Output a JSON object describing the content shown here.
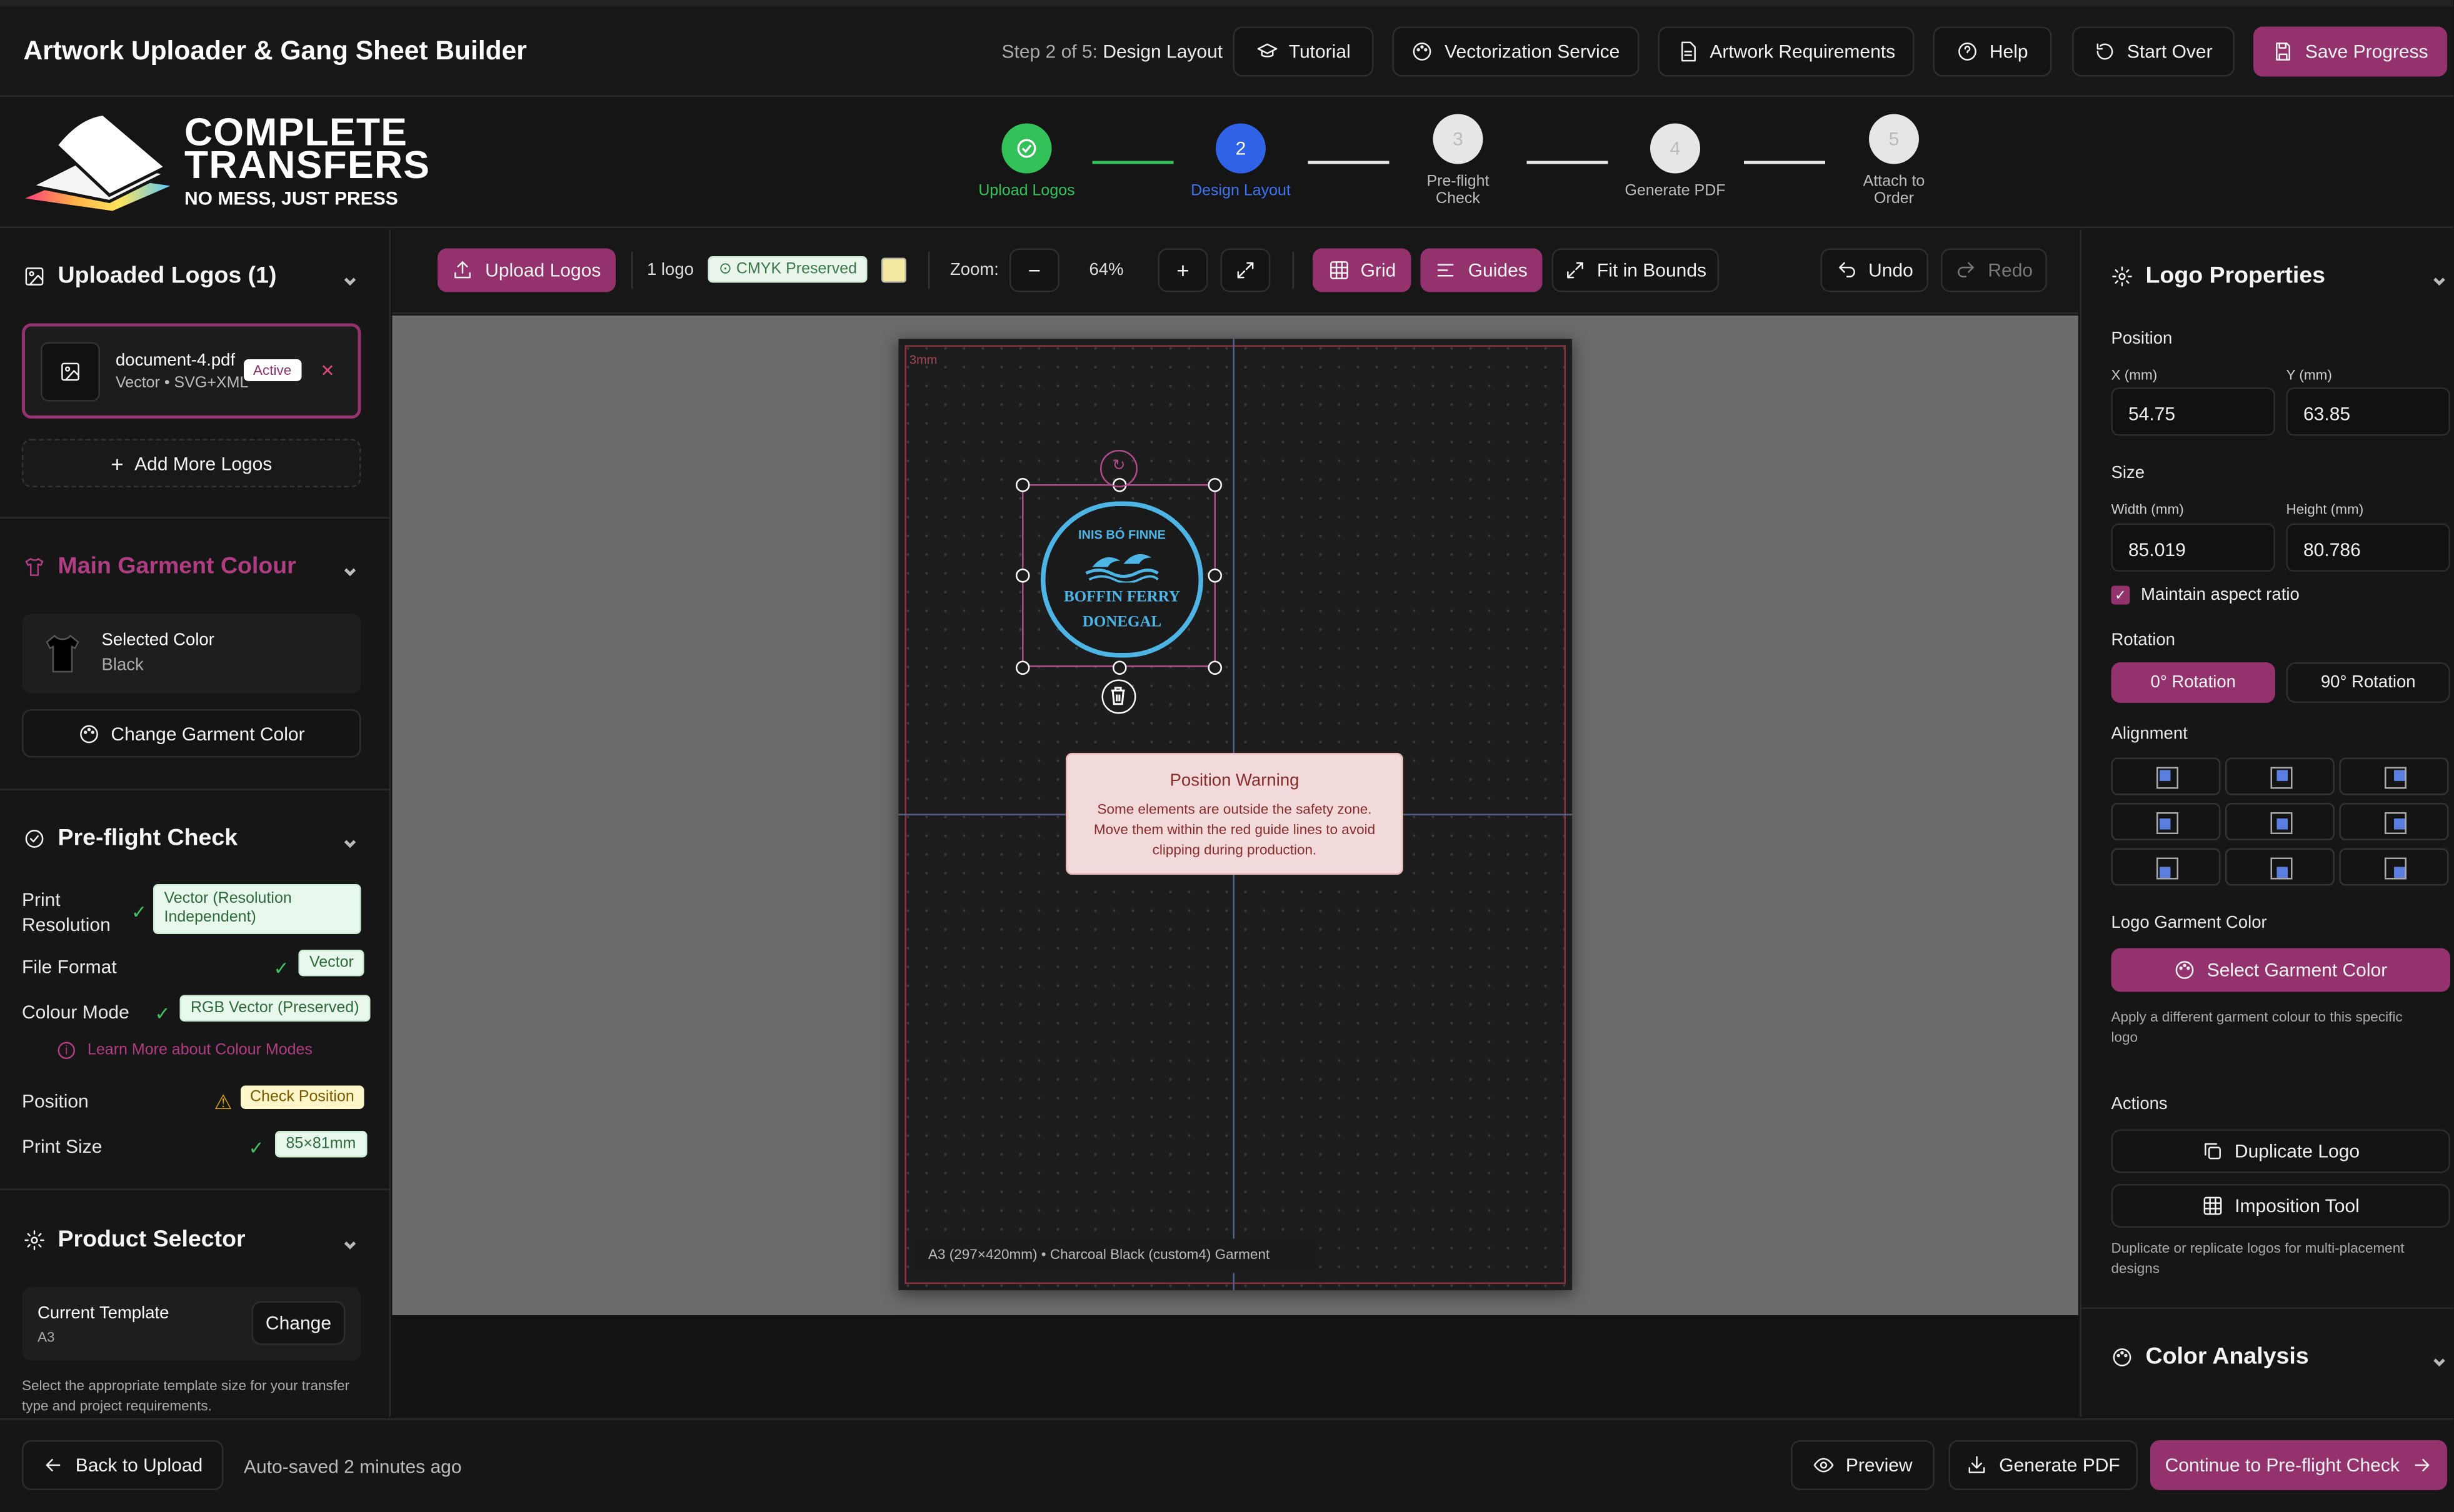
{
  "header": {
    "title": "Artwork Uploader & Gang Sheet Builder",
    "step_prefix": "Step 2 of 5:",
    "step_name": "Design Layout",
    "buttons": {
      "tutorial": "Tutorial",
      "vectorization": "Vectorization Service",
      "requirements": "Artwork Requirements",
      "help": "Help",
      "start_over": "Start Over",
      "save": "Save Progress"
    }
  },
  "brand": {
    "line1": "COMPLETE",
    "line2": "TRANSFERS",
    "tagline": "NO MESS, JUST PRESS"
  },
  "stepper": [
    {
      "num": "1",
      "label": "Upload Logos",
      "state": "done"
    },
    {
      "num": "2",
      "label": "Design Layout",
      "state": "active"
    },
    {
      "num": "3",
      "label": "Pre-flight Check",
      "state": "todo"
    },
    {
      "num": "4",
      "label": "Generate PDF",
      "state": "todo"
    },
    {
      "num": "5",
      "label": "Attach to Order",
      "state": "todo"
    }
  ],
  "left": {
    "uploaded": {
      "title": "Uploaded Logos (1)",
      "file": {
        "name": "document-4.pdf",
        "meta": "Vector • SVG+XML",
        "badge": "Active"
      },
      "add_more": "Add More Logos"
    },
    "garment": {
      "title": "Main Garment Colour",
      "selected_label": "Selected Color",
      "selected_value": "Black",
      "change_button": "Change Garment Color"
    },
    "preflight": {
      "title": "Pre-flight Check",
      "rows": [
        {
          "label": "Print Resolution",
          "value": "Vector (Resolution Independent)",
          "status": "ok"
        },
        {
          "label": "File Format",
          "value": "Vector",
          "status": "ok"
        },
        {
          "label": "Colour Mode",
          "value": "RGB Vector (Preserved)",
          "status": "ok"
        },
        {
          "label": "Position",
          "value": "Check Position",
          "status": "warn"
        },
        {
          "label": "Print Size",
          "value": "85×81mm",
          "status": "ok"
        }
      ],
      "learn_more": "Learn More about Colour Modes"
    },
    "product": {
      "title": "Product Selector",
      "current_label": "Current Template",
      "current_value": "A3",
      "change_button": "Change",
      "note": "Select the appropriate template size for your transfer type and project requirements."
    }
  },
  "toolbar": {
    "upload": "Upload Logos",
    "count": "1 logo",
    "cmyk": "CMYK Preserved",
    "zoom_label": "Zoom:",
    "zoom_value": "64%",
    "grid": "Grid",
    "guides": "Guides",
    "fit": "Fit in Bounds",
    "undo": "Undo",
    "redo": "Redo"
  },
  "canvas": {
    "safety_label": "3mm",
    "logo": {
      "top": "INIS BÓ FINNE",
      "line1": "BOFFIN FERRY",
      "line2": "DONEGAL"
    },
    "warning": {
      "title": "Position Warning",
      "body": "Some elements are outside the safety zone. Move them within the red guide lines to avoid clipping during production."
    },
    "footer": "A3 (297×420mm) • Charcoal Black (custom4) Garment"
  },
  "right": {
    "title": "Logo Properties",
    "position_title": "Position",
    "x_label": "X (mm)",
    "x_value": "54.75",
    "y_label": "Y (mm)",
    "y_value": "63.85",
    "size_title": "Size",
    "w_label": "Width (mm)",
    "w_value": "85.019",
    "h_label": "Height (mm)",
    "h_value": "80.786",
    "aspect_label": "Maintain aspect ratio",
    "rotation_title": "Rotation",
    "rot0": "0° Rotation",
    "rot90": "90° Rotation",
    "alignment_title": "Alignment",
    "garment_title": "Logo Garment Color",
    "garment_button": "Select Garment Color",
    "garment_note": "Apply a different garment colour to this specific logo",
    "actions_title": "Actions",
    "duplicate": "Duplicate Logo",
    "imposition": "Imposition Tool",
    "actions_note": "Duplicate or replicate logos for multi-placement designs",
    "color_analysis": "Color Analysis"
  },
  "footer": {
    "back": "Back to Upload",
    "autosave": "Auto-saved 2 minutes ago",
    "preview": "Preview",
    "generate": "Generate PDF",
    "continue": "Continue to Pre-flight Check"
  },
  "colors": {
    "accent": "#93326c",
    "active_step": "#2f62e6",
    "done_step": "#33c25a",
    "guide": "#c0394f"
  }
}
